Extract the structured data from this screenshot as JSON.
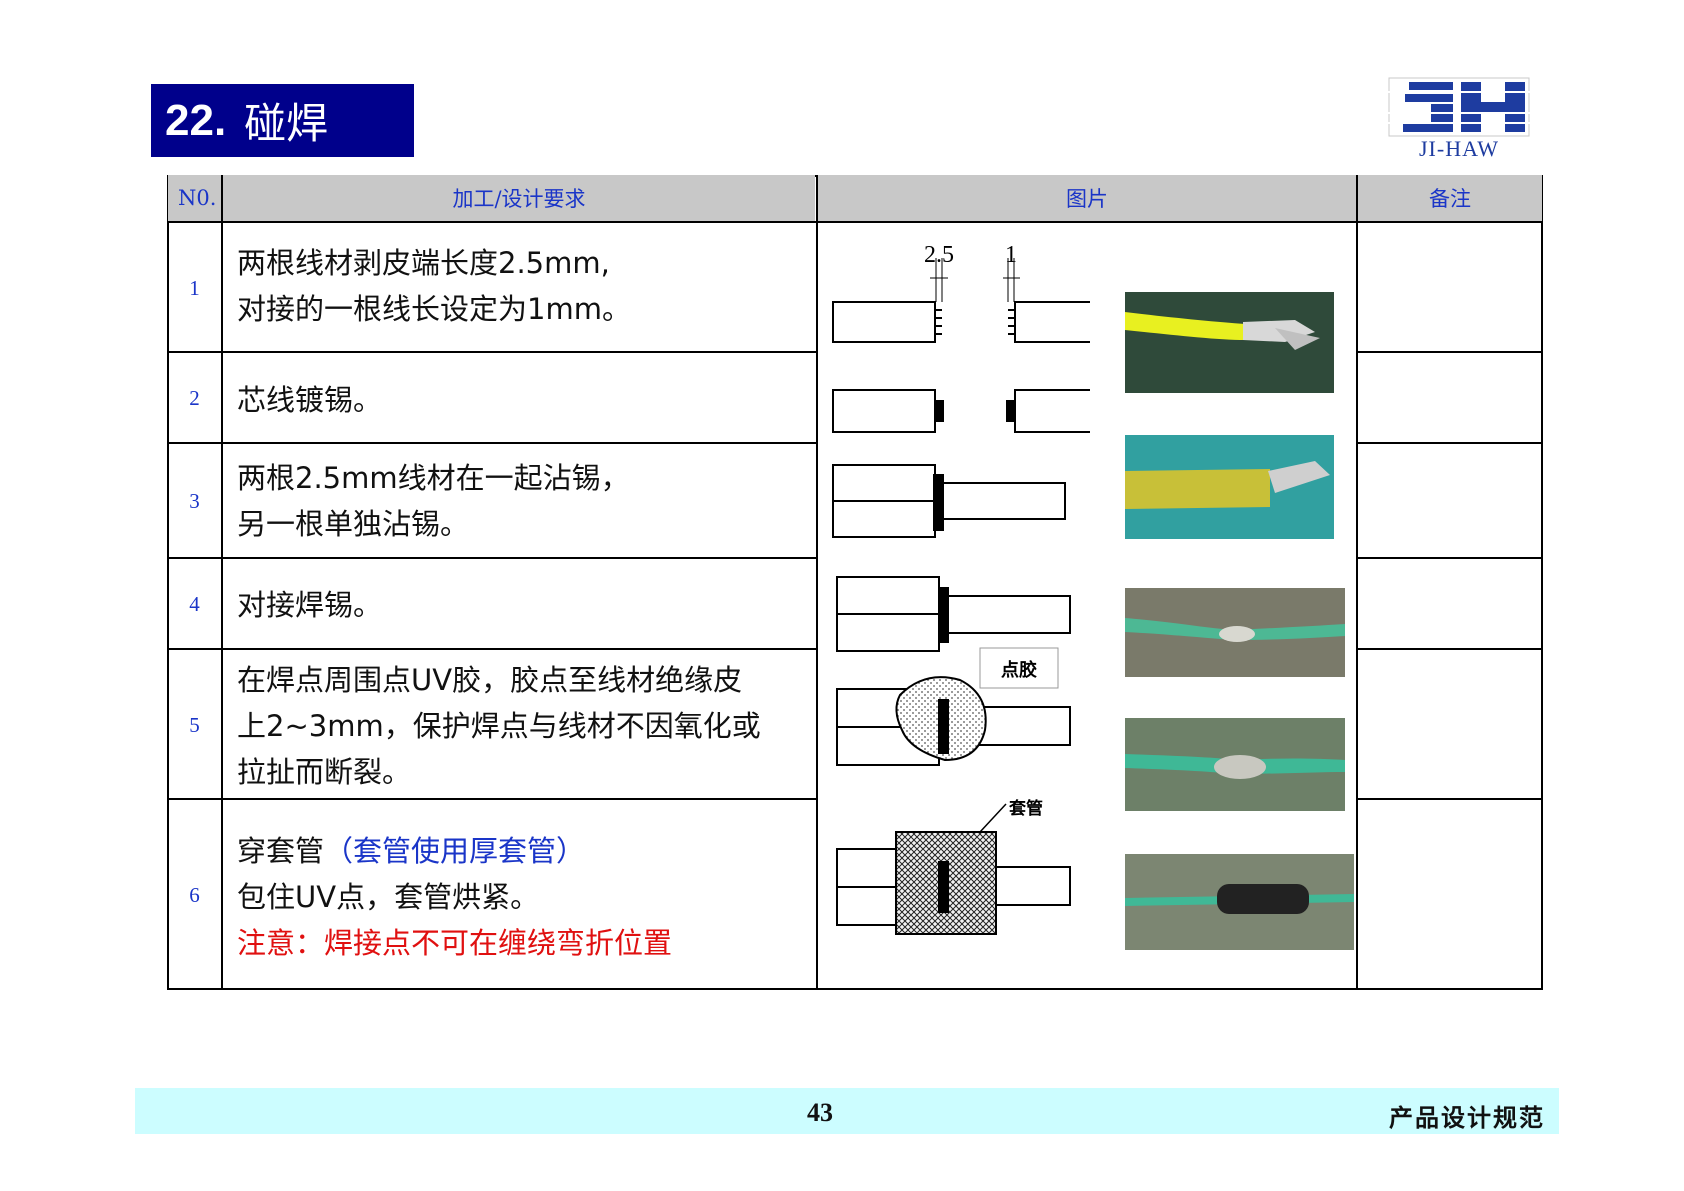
{
  "header": {
    "section_number": "22.",
    "section_title": "碰焊",
    "logo_text": "JI-HAW"
  },
  "table": {
    "columns": [
      "N0.",
      "加工/设计要求",
      "图片",
      "备注"
    ],
    "rows": [
      {
        "no": "1",
        "lines": [
          "两根线材剥皮端长度2.5mm,",
          "对接的一根线长设定为1mm。"
        ]
      },
      {
        "no": "2",
        "lines": [
          "芯线镀锡。"
        ]
      },
      {
        "no": "3",
        "lines": [
          "两根2.5mm线材在一起沾锡，",
          "另一根单独沾锡。"
        ]
      },
      {
        "no": "4",
        "lines": [
          "对接焊锡。"
        ]
      },
      {
        "no": "5",
        "lines": [
          "在焊点周围点UV胶，胶点至线材绝缘皮",
          "上2~3mm，保护焊点与线材不因氧化或",
          "拉扯而断裂。"
        ]
      },
      {
        "no": "6",
        "line1_a": "穿套管",
        "line1_b": "（套管使用厚套管）",
        "line2": "包住UV点，套管烘紧。",
        "line3": "注意：焊接点不可在缠绕弯折位置"
      }
    ],
    "diagram_labels": {
      "dim_a": "2.5",
      "dim_b": "1",
      "glue": "点胶",
      "sleeve": "套管"
    }
  },
  "footer": {
    "page_number": "43",
    "doc_title": "产品设计规范"
  },
  "colors": {
    "title_bg": "#00008b",
    "header_bg": "#c8c8c8",
    "blue_text": "#1a35c8",
    "red_text": "#e01010",
    "footer_bg": "#ccfdff"
  }
}
